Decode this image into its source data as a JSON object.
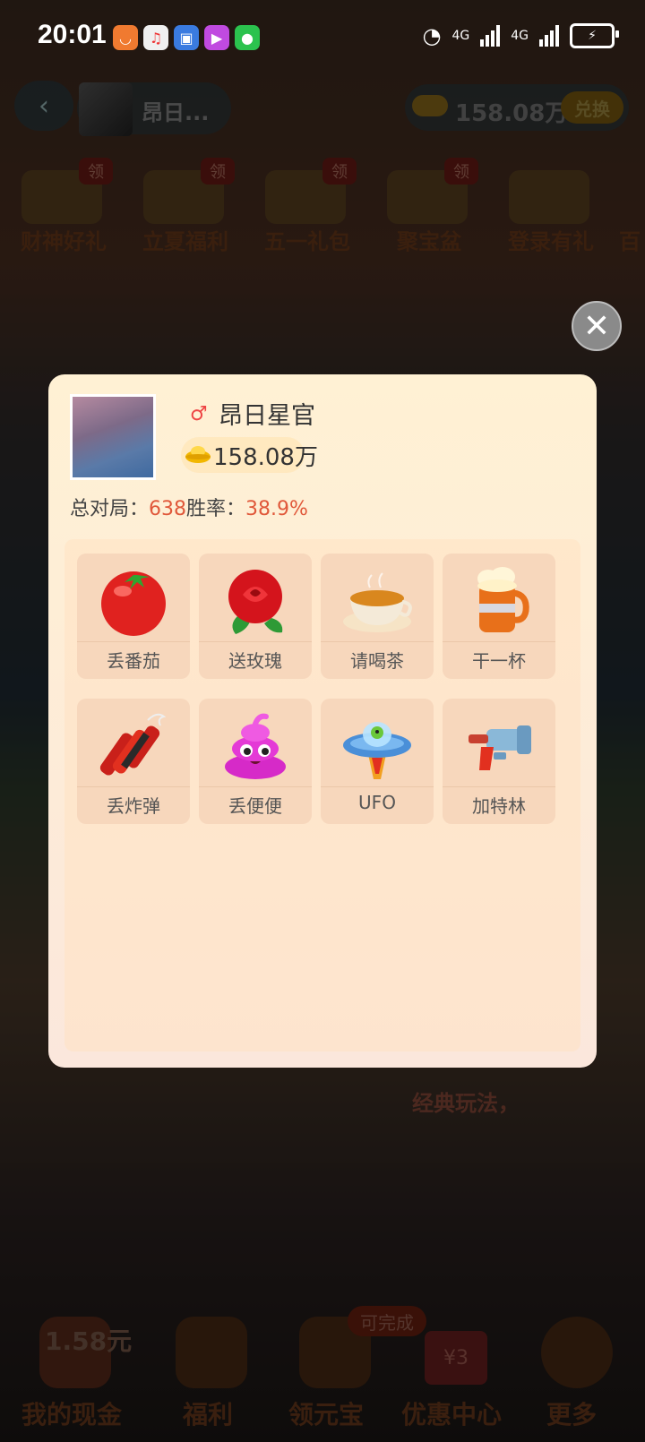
{
  "status_bar": {
    "time": "20:01",
    "network_1": "4G",
    "network_2": "4G",
    "apps": [
      "taobao-icon",
      "music-icon",
      "files-icon",
      "video-icon",
      "wechat-icon"
    ]
  },
  "top_bar": {
    "user_name": "昂日...",
    "coin_amount": "158.08万",
    "exchange_label": "兑换"
  },
  "promos": [
    {
      "label": "财神好礼",
      "badge": "领"
    },
    {
      "label": "立夏福利",
      "badge": "领"
    },
    {
      "label": "五一礼包",
      "badge": "领"
    },
    {
      "label": "聚宝盆",
      "badge": "领"
    },
    {
      "label": "登录有礼",
      "badge": ""
    },
    {
      "label": "百",
      "badge": ""
    }
  ],
  "dialog": {
    "name": "昂日星官",
    "coins": "158.08万",
    "stats_total_label": "总对局：",
    "stats_total_value": "638",
    "stats_rate_label": "胜率：",
    "stats_rate_value": "38.9%",
    "gifts": [
      {
        "label": "丢番茄",
        "icon": "tomato-icon"
      },
      {
        "label": "送玫瑰",
        "icon": "rose-icon"
      },
      {
        "label": "请喝茶",
        "icon": "tea-icon"
      },
      {
        "label": "干一杯",
        "icon": "beer-icon"
      },
      {
        "label": "丢炸弹",
        "icon": "dynamite-icon"
      },
      {
        "label": "丢便便",
        "icon": "poop-icon"
      },
      {
        "label": "UFO",
        "icon": "ufo-icon"
      },
      {
        "label": "加特林",
        "icon": "gatling-icon"
      }
    ]
  },
  "background_text": {
    "mode_desc": "经典玩法，"
  },
  "bottom_bar": {
    "cash_amount": "1.58元",
    "items": [
      "我的现金",
      "福利",
      "领元宝",
      "优惠中心",
      "更多"
    ],
    "badge": "可完成",
    "coupon": "¥3"
  }
}
